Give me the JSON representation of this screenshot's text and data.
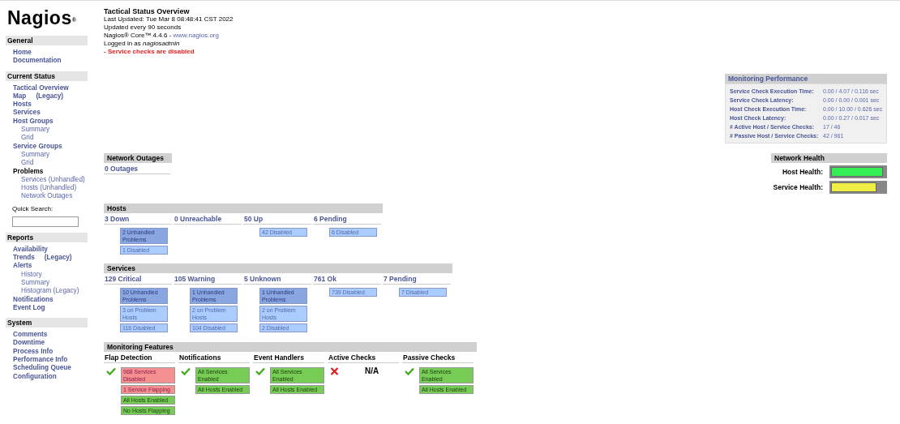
{
  "logo": {
    "text": "Nagios",
    "mark": "®"
  },
  "sidebar": [
    {
      "title": "General",
      "items": [
        {
          "label": "Home",
          "kind": "link"
        },
        {
          "label": "Documentation",
          "kind": "link"
        }
      ]
    },
    {
      "title": "Current Status",
      "items": [
        {
          "label": "Tactical Overview",
          "kind": "link"
        },
        {
          "label": "Map",
          "extra": "(Legacy)",
          "kind": "link"
        },
        {
          "label": "Hosts",
          "kind": "link"
        },
        {
          "label": "Services",
          "kind": "link"
        },
        {
          "label": "Host Groups",
          "kind": "link",
          "children": [
            {
              "label": "Summary"
            },
            {
              "label": "Grid"
            }
          ]
        },
        {
          "label": "Service Groups",
          "kind": "link",
          "children": [
            {
              "label": "Summary"
            },
            {
              "label": "Grid"
            }
          ]
        },
        {
          "label": "Problems",
          "kind": "heading",
          "children": [
            {
              "label": "Services",
              "extra": "(Unhandled)"
            },
            {
              "label": "Hosts",
              "extra": "(Unhandled)"
            },
            {
              "label": "Network Outages"
            }
          ]
        },
        {
          "label": "Quick Search:",
          "kind": "search"
        }
      ]
    },
    {
      "title": "Reports",
      "items": [
        {
          "label": "Availability",
          "kind": "link"
        },
        {
          "label": "Trends",
          "extra": "(Legacy)",
          "kind": "link"
        },
        {
          "label": "Alerts",
          "kind": "link",
          "children": [
            {
              "label": "History"
            },
            {
              "label": "Summary"
            },
            {
              "label": "Histogram (Legacy)"
            }
          ]
        },
        {
          "label": "Notifications",
          "kind": "link"
        },
        {
          "label": "Event Log",
          "kind": "link"
        }
      ]
    },
    {
      "title": "System",
      "items": [
        {
          "label": "Comments",
          "kind": "link"
        },
        {
          "label": "Downtime",
          "kind": "link"
        },
        {
          "label": "Process Info",
          "kind": "link"
        },
        {
          "label": "Performance Info",
          "kind": "link"
        },
        {
          "label": "Scheduling Queue",
          "kind": "link"
        },
        {
          "label": "Configuration",
          "kind": "link"
        }
      ]
    }
  ],
  "header": {
    "title": "Tactical Status Overview",
    "updated": "Last Updated: Tue Mar 8 08:48:41 CST 2022",
    "interval": "Updated every 90 seconds",
    "version": "Nagios® Core™ 4.4.6 - ",
    "version_link": "www.nagios.org",
    "login": "Logged in as *nagiosadmin*",
    "warning": "- Service checks are disabled"
  },
  "performance": {
    "title": "Monitoring Performance",
    "rows": [
      {
        "label": "Service Check Execution Time:",
        "value": "0.00 / 4.07 / 0.116 sec"
      },
      {
        "label": "Service Check Latency:",
        "value": "0.00 / 0.00 / 0.001 sec"
      },
      {
        "label": "Host Check Execution Time:",
        "value": "0.00 / 10.00 / 0.626 sec"
      },
      {
        "label": "Host Check Latency:",
        "value": "0.00 / 0.27 / 0.017 sec"
      },
      {
        "label": "# Active Host / Service Checks:",
        "value": "17 / 46"
      },
      {
        "label": "# Passive Host / Service Checks:",
        "value": "42 / 961"
      }
    ]
  },
  "network_outages": {
    "title": "Network Outages",
    "value": "0 Outages"
  },
  "network_health": {
    "title": "Network Health",
    "bars": [
      {
        "label": "Host Health:",
        "level": 0.96,
        "color": "#33ee55"
      },
      {
        "label": "Service Health:",
        "level": 0.83,
        "color": "#eeee44"
      }
    ]
  },
  "hosts": {
    "title": "Hosts",
    "columns": [
      {
        "label": "3 Down",
        "boxes": [
          {
            "text": "2 Unhandled Problems",
            "kind": "unhandled"
          },
          {
            "text": "1 Disabled",
            "kind": "disabled"
          }
        ]
      },
      {
        "label": "0 Unreachable"
      },
      {
        "label": "50 Up",
        "boxes": [
          {
            "text": "42 Disabled",
            "kind": "disabled"
          }
        ]
      },
      {
        "label": "6 Pending",
        "boxes": [
          {
            "text": "6 Disabled",
            "kind": "disabled"
          }
        ]
      }
    ]
  },
  "services": {
    "title": "Services",
    "columns": [
      {
        "label": "129 Critical",
        "boxes": [
          {
            "text": "10 Unhandled Problems",
            "kind": "unhandled"
          },
          {
            "text": "3 on Problem Hosts",
            "kind": "disabled"
          },
          {
            "text": "116 Disabled",
            "kind": "disabled"
          }
        ]
      },
      {
        "label": "105 Warning",
        "boxes": [
          {
            "text": "1 Unhandled Problems",
            "kind": "unhandled"
          },
          {
            "text": "2 on Problem Hosts",
            "kind": "disabled"
          },
          {
            "text": "104 Disabled",
            "kind": "disabled"
          }
        ]
      },
      {
        "label": "5 Unknown",
        "boxes": [
          {
            "text": "1 Unhandled Problems",
            "kind": "unhandled"
          },
          {
            "text": "2 on Problem Hosts",
            "kind": "disabled"
          },
          {
            "text": "2 Disabled",
            "kind": "disabled"
          }
        ]
      },
      {
        "label": "761 Ok",
        "boxes": [
          {
            "text": "739 Disabled",
            "kind": "disabled"
          }
        ]
      },
      {
        "label": "7 Pending",
        "boxes": [
          {
            "text": "7 Disabled",
            "kind": "disabled"
          }
        ]
      }
    ]
  },
  "features": {
    "title": "Monitoring Features",
    "columns": [
      {
        "label": "Flap Detection",
        "enabled": true,
        "boxes": [
          {
            "text": "968 Services Disabled",
            "kind": "bad"
          },
          {
            "text": "1 Service Flapping",
            "kind": "bad"
          },
          {
            "text": "All Hosts Enabled",
            "kind": "good"
          },
          {
            "text": "No Hosts Flapping",
            "kind": "good"
          }
        ]
      },
      {
        "label": "Notifications",
        "enabled": true,
        "boxes": [
          {
            "text": "All Services Enabled",
            "kind": "good"
          },
          {
            "text": "All Hosts Enabled",
            "kind": "good"
          }
        ]
      },
      {
        "label": "Event Handlers",
        "enabled": true,
        "boxes": [
          {
            "text": "All Services Enabled",
            "kind": "good"
          },
          {
            "text": "All Hosts Enabled",
            "kind": "good"
          }
        ]
      },
      {
        "label": "Active Checks",
        "enabled": false,
        "na": "N/A"
      },
      {
        "label": "Passive Checks",
        "enabled": true,
        "boxes": [
          {
            "text": "All Services Enabled",
            "kind": "good"
          },
          {
            "text": "All Hosts Enabled",
            "kind": "good"
          }
        ]
      }
    ]
  }
}
